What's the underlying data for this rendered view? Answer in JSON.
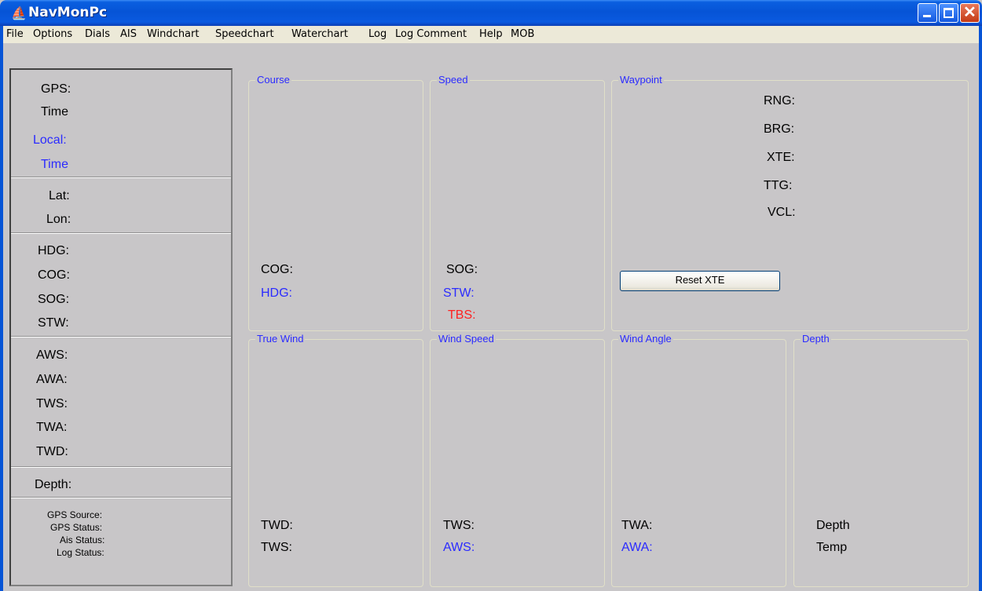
{
  "window": {
    "title": "NavMonPc",
    "icon": "sailboat-icon"
  },
  "menu": [
    "File",
    "Options",
    "Dials",
    "AIS",
    "Windchart",
    "Speedchart",
    "Waterchart",
    "Log",
    "Log Comment",
    "Help",
    "MOB"
  ],
  "left": {
    "gps": "GPS:",
    "time": "Time",
    "local": "Local:",
    "local_time": "Time",
    "lat": "Lat:",
    "lon": "Lon:",
    "hdg": "HDG:",
    "cog": "COG:",
    "sog": "SOG:",
    "stw": "STW:",
    "aws": "AWS:",
    "awa": "AWA:",
    "tws": "TWS:",
    "twa": "TWA:",
    "twd": "TWD:",
    "depth": "Depth:",
    "gps_source": "GPS Source:",
    "gps_status": "GPS Status:",
    "ais_status": "Ais Status:",
    "log_status": "Log Status:"
  },
  "course": {
    "title": "Course",
    "cog": "COG:",
    "hdg": "HDG:"
  },
  "speed": {
    "title": "Speed",
    "sog": "SOG:",
    "stw": "STW:",
    "tbs": "TBS:"
  },
  "waypoint": {
    "title": "Waypoint",
    "rng": "RNG:",
    "brg": "BRG:",
    "xte": "XTE:",
    "ttg": "TTG:",
    "vcl": "VCL:",
    "reset": "Reset XTE"
  },
  "truewind": {
    "title": "True Wind",
    "twd": "TWD:",
    "tws": "TWS:"
  },
  "windspeed": {
    "title": "Wind Speed",
    "tws": "TWS:",
    "aws": "AWS:"
  },
  "windangle": {
    "title": "Wind Angle",
    "twa": "TWA:",
    "awa": "AWA:"
  },
  "depth": {
    "title": "Depth",
    "depth": "Depth",
    "temp": "Temp"
  },
  "colors": {
    "accent": "#2b2bff",
    "alert": "#ff2020",
    "titlebar": "#0654d6"
  }
}
